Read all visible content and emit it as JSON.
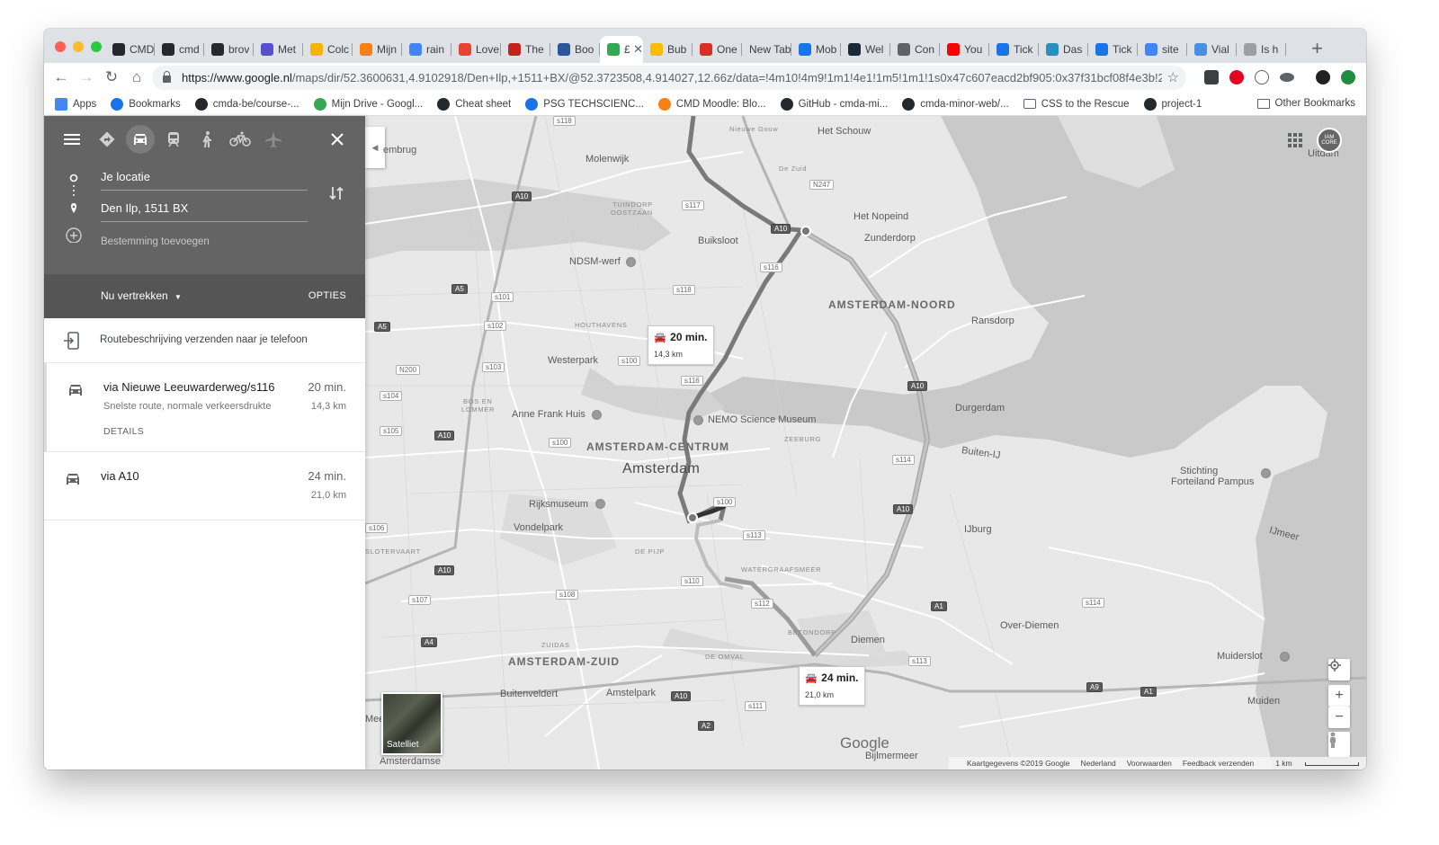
{
  "browser": {
    "traffic_colors": [
      "#ff5f57",
      "#febc2e",
      "#28c840"
    ],
    "tabs": [
      {
        "label": "CMD",
        "icon": "github-icon",
        "color": "#24292e"
      },
      {
        "label": "cmd",
        "icon": "github-icon",
        "color": "#24292e"
      },
      {
        "label": "brov",
        "icon": "github-icon",
        "color": "#24292e"
      },
      {
        "label": "Met",
        "icon": "m-icon",
        "color": "#5a4fcf"
      },
      {
        "label": "Colc",
        "icon": "drive-icon",
        "color": "#f4b400"
      },
      {
        "label": "Mijn",
        "icon": "moodle-icon",
        "color": "#f98012"
      },
      {
        "label": "rain",
        "icon": "google-icon",
        "color": "#4285f4"
      },
      {
        "label": "Love",
        "icon": "e-icon",
        "color": "#ea4335"
      },
      {
        "label": "The",
        "icon": "news-icon",
        "color": "#c5221f"
      },
      {
        "label": "Boo",
        "icon": "word-icon",
        "color": "#2b579a"
      },
      {
        "label": "£",
        "icon": "maps-icon",
        "color": "#34a853",
        "active": true,
        "close": "✕"
      },
      {
        "label": "Bub",
        "icon": "emoji-icon",
        "color": "#fbbc04"
      },
      {
        "label": "One",
        "icon": "pdf-icon",
        "color": "#d93025"
      },
      {
        "label": "New Tab",
        "icon": "none",
        "color": "transparent"
      },
      {
        "label": "Mob",
        "icon": "chrome-icon",
        "color": "#1a73e8"
      },
      {
        "label": "Wel",
        "icon": "steam-icon",
        "color": "#1b2838"
      },
      {
        "label": "Con",
        "icon": "doc-icon",
        "color": "#5f6368"
      },
      {
        "label": "You",
        "icon": "youtube-icon",
        "color": "#ff0000"
      },
      {
        "label": "Tick",
        "icon": "t-icon",
        "color": "#1a73e8"
      },
      {
        "label": "Das",
        "icon": "tk-icon",
        "color": "#2a8fbd"
      },
      {
        "label": "Tick",
        "icon": "t-icon",
        "color": "#1a73e8"
      },
      {
        "label": "site",
        "icon": "google-icon",
        "color": "#4285f4"
      },
      {
        "label": "Vial",
        "icon": "viable-icon",
        "color": "#4a90e2"
      },
      {
        "label": "Is h",
        "icon": "page-icon",
        "color": "#9aa0a6"
      }
    ],
    "new_tab": "+",
    "url_host": "https://www.google.nl",
    "url_path": "/maps/dir/52.3600631,4.9102918/Den+Ilp,+1511+BX/@52.3723508,4.914027,12.66z/data=!4m10!4m9!1m1!4e1!1m5!1m1!1s0x47c607eacd2bf905:0x37f31bcf08f4e3b!2...",
    "bookmarks": [
      {
        "label": "Apps",
        "icon": "apps-grid-icon",
        "color": "#4285f4"
      },
      {
        "label": "Bookmarks",
        "icon": "star-icon",
        "color": "#1a73e8"
      },
      {
        "label": "cmda-be/course-...",
        "icon": "github-icon",
        "color": "#24292e"
      },
      {
        "label": "Mijn Drive - Googl...",
        "icon": "drive-icon",
        "color": "#34a853"
      },
      {
        "label": "Cheat sheet",
        "icon": "github-icon",
        "color": "#24292e"
      },
      {
        "label": "PSG TECHSCIENC...",
        "icon": "snowflake-icon",
        "color": "#1a73e8"
      },
      {
        "label": "CMD Moodle: Blo...",
        "icon": "moodle-icon",
        "color": "#f98012"
      },
      {
        "label": "GitHub - cmda-mi...",
        "icon": "github-icon",
        "color": "#24292e"
      },
      {
        "label": "cmda-minor-web/...",
        "icon": "github-icon",
        "color": "#24292e"
      },
      {
        "label": "CSS to the Rescue",
        "icon": "folder-icon",
        "color": "#5f6368"
      },
      {
        "label": "project-1",
        "icon": "github-icon",
        "color": "#24292e"
      }
    ],
    "other_bookmarks": "Other Bookmarks"
  },
  "directions": {
    "origin": "Je locatie",
    "destination": "Den Ilp, 1511 BX",
    "add_destination": "Bestemming toevoegen",
    "depart": "Nu vertrekken",
    "options": "OPTIES",
    "send_to_phone": "Routebeschrijving verzenden naar je telefoon",
    "routes": [
      {
        "title": "via Nieuwe Leeuwarderweg/s116",
        "subtitle": "Snelste route, normale verkeersdrukte",
        "duration": "20 min.",
        "distance": "14,3 km",
        "details": "DETAILS"
      },
      {
        "title": "via A10",
        "subtitle": "",
        "duration": "24 min.",
        "distance": "21,0 km",
        "details": ""
      }
    ]
  },
  "map": {
    "callouts": [
      {
        "duration": "20 min.",
        "distance": "14,3 km"
      },
      {
        "duration": "24 min.",
        "distance": "21,0 km"
      }
    ],
    "labels": {
      "het_schouw": "Het Schouw",
      "uitdam": "Uitdam",
      "molenwijk": "Molenwijk",
      "nieuwe_gouw": "Nieuwe Gouw",
      "de_zuid": "De Zuid",
      "het_nopeind": "Het Nopeind",
      "zunderdorp": "Zunderdorp",
      "buiksloot": "Buiksloot",
      "tuindorp": "TUINDORP",
      "oostzaan": "OOSTZAAN",
      "ndsm": "NDSM-werf",
      "amsterdam_noord": "AMSTERDAM-NOORD",
      "ransdorp": "Ransdorp",
      "houthavens": "HOUTHAVENS",
      "westerpark": "Westerpark",
      "bos_en": "BOS EN",
      "lommer": "LOMMER",
      "anne_frank": "Anne Frank Huis",
      "nemo": "NEMO Science Museum",
      "zeeburg": "ZEEBURG",
      "durgerdam": "Durgerdam",
      "buiten_ij": "Buiten-IJ",
      "centrum": "AMSTERDAM-CENTRUM",
      "amsterdam": "Amsterdam",
      "stichting": "Stichting",
      "forteiland": "Forteiland Pampus",
      "rijksmuseum": "Rijksmuseum",
      "vondelpark": "Vondelpark",
      "ijburg": "IJburg",
      "ijmeer": "IJmeer",
      "slotervaart": "SLOTERVAART",
      "de_pijp": "DE PIJP",
      "watergraafsmeer": "WATERGRAAFSMEER",
      "over_diemen": "Over-Diemen",
      "betondorp": "BETONDORP",
      "diemen": "Diemen",
      "zuidas": "ZUIDAS",
      "amsterdam_zuid": "AMSTERDAM-ZUID",
      "de_omval": "DE OMVAL",
      "muiderslot": "Muiderslot",
      "buitenveldert": "Buitenveldert",
      "amstelpark": "Amstelpark",
      "muiden": "Muiden",
      "bijlmermeer": "Bijlmermeer",
      "amsterdamse": "Amsterdamse",
      "embrug": "embrug",
      "mee": "Mee"
    },
    "satellite_label": "Satelliet",
    "google": "Google",
    "footer": {
      "copyright": "Kaartgegevens ©2019 Google",
      "country": "Nederland",
      "terms": "Voorwaarden",
      "feedback": "Feedback verzenden",
      "scale": "1 km"
    },
    "zoom_in": "+",
    "zoom_out": "−",
    "account": "IAM CORE"
  }
}
